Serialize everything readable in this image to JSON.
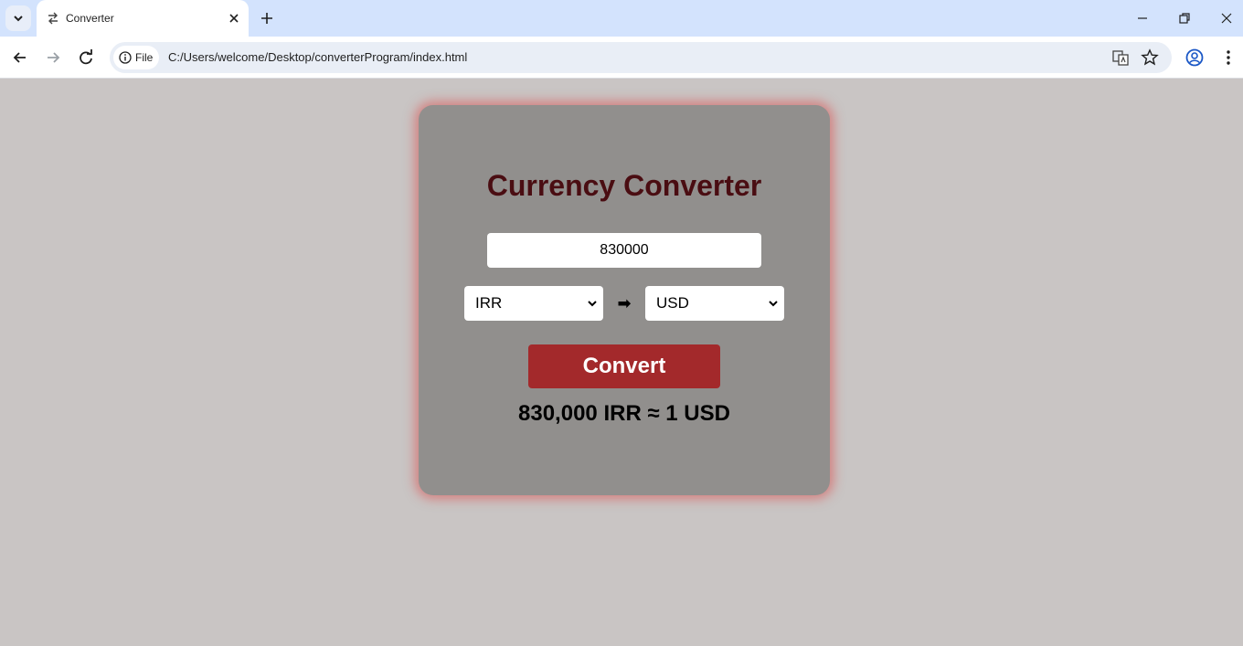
{
  "browser": {
    "tab_title": "Converter",
    "site_chip_label": "File",
    "url": "C:/Users/welcome/Desktop/converterProgram/index.html"
  },
  "converter": {
    "title": "Currency Converter",
    "amount_value": "830000",
    "from_currency": "IRR",
    "to_currency": "USD",
    "arrow": "➡",
    "convert_label": "Convert",
    "result": "830,000 IRR ≈ 1 USD"
  },
  "colors": {
    "title": "#4a0d12",
    "button": "#a3292b",
    "card": "#918f8d",
    "page_background": "#c9c5c4"
  }
}
